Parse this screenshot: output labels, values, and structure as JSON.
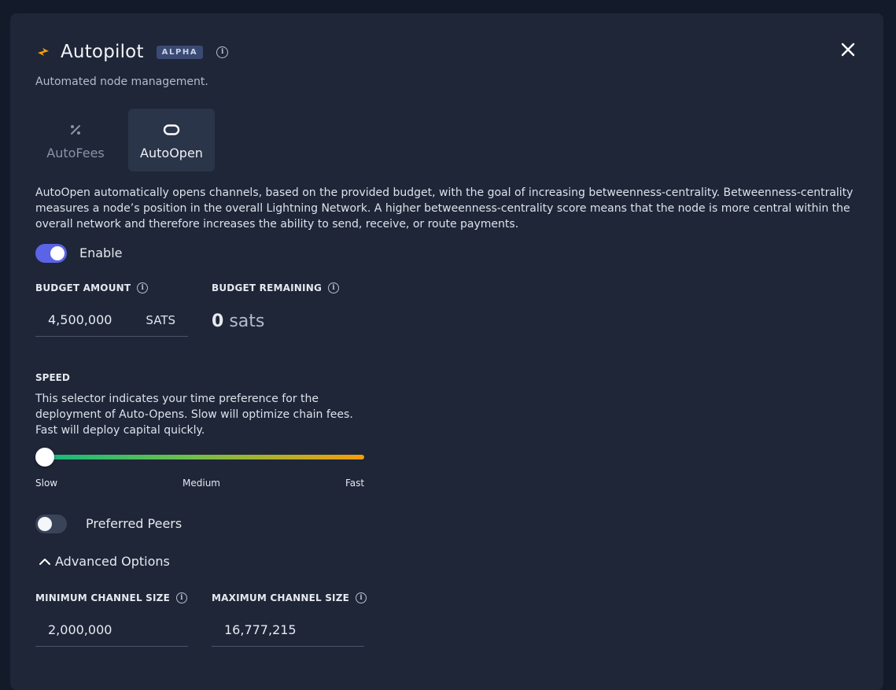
{
  "header": {
    "title": "Autopilot",
    "badge": "ALPHA",
    "subtitle": "Automated node management.",
    "accent_color": "#f59e0b"
  },
  "tabs": [
    {
      "label": "AutoFees",
      "icon": "percent-icon",
      "active": false
    },
    {
      "label": "AutoOpen",
      "icon": "channel-icon",
      "active": true
    }
  ],
  "description": "AutoOpen automatically opens channels, based on the provided budget, with the goal of increasing betweenness-centrality. Betweenness-centrality measures a node’s position in the overall Lightning Network. A higher betweenness-centrality score means that the node is more central within the overall network and therefore increases the ability to send, receive, or route payments.",
  "enable": {
    "label": "Enable",
    "on": true,
    "color": "#5b63e6"
  },
  "budget": {
    "label": "BUDGET AMOUNT",
    "value": "4,500,000",
    "unit": "SATS",
    "remaining_label": "BUDGET REMAINING",
    "remaining_value": "0",
    "remaining_unit": "sats"
  },
  "speed": {
    "label": "SPEED",
    "description": "This selector indicates your time preference for the deployment of Auto-Opens. Slow will optimize chain fees. Fast will deploy capital quickly.",
    "ticks": [
      "Slow",
      "Medium",
      "Fast"
    ],
    "selected": "Slow",
    "gradient_start": "#10b981",
    "gradient_end": "#f59e0b"
  },
  "preferred_peers": {
    "label": "Preferred Peers",
    "on": false
  },
  "advanced": {
    "label": "Advanced Options",
    "min_label": "MINIMUM CHANNEL SIZE",
    "min_value": "2,000,000",
    "max_label": "MAXIMUM CHANNEL SIZE",
    "max_value": "16,777,215"
  }
}
